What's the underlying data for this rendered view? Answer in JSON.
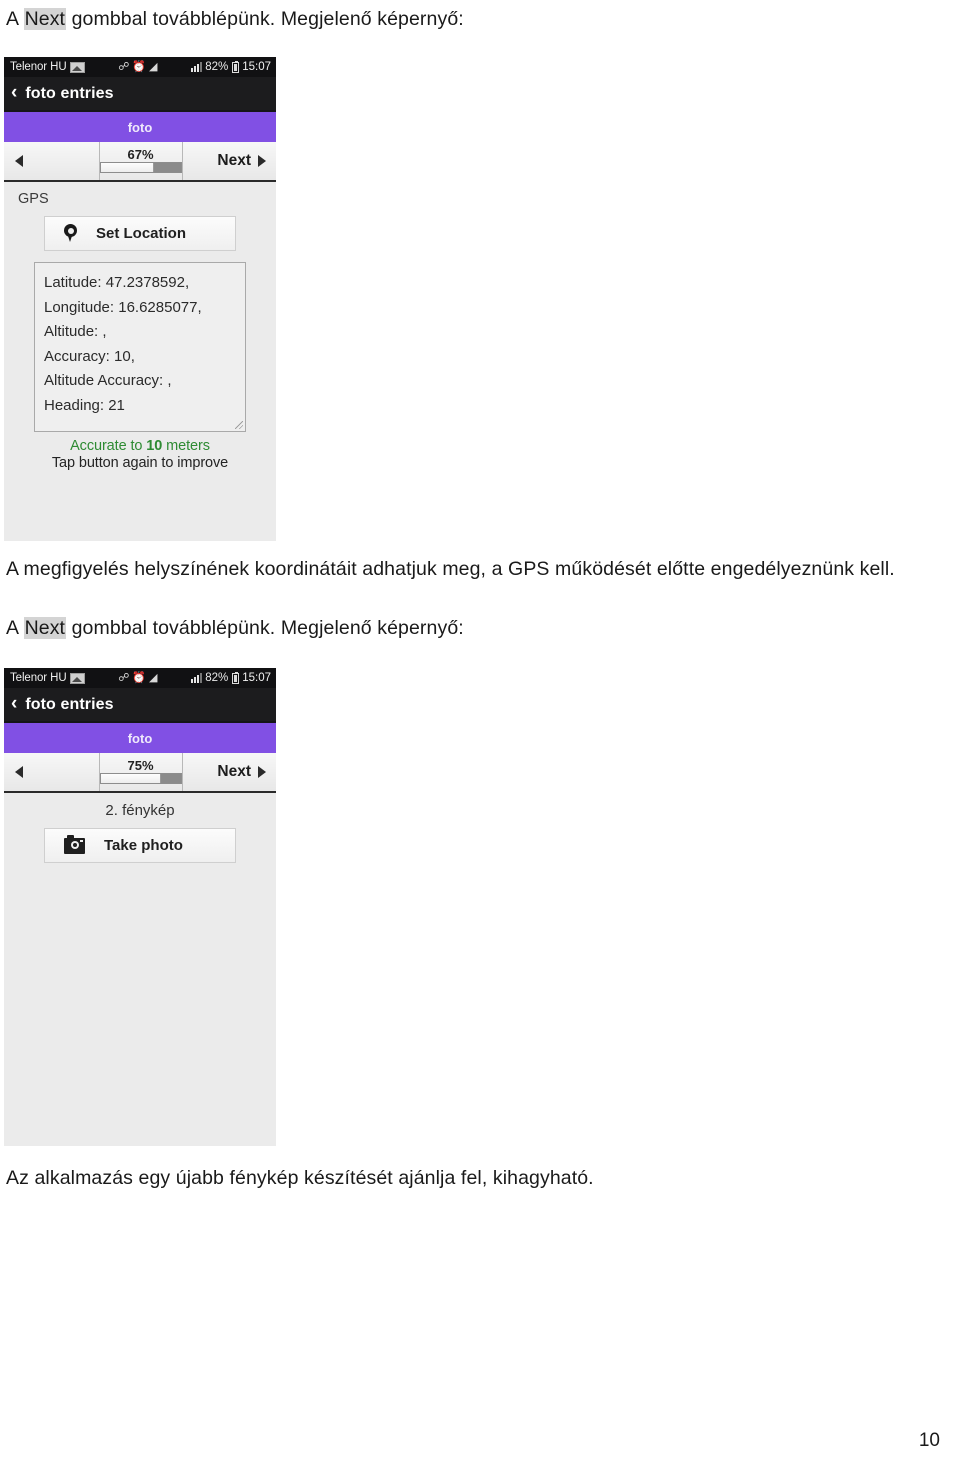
{
  "document": {
    "paragraph_1": "A Next gombbal továbblépünk. Megjelenő képernyő:",
    "paragraph_1_prefix": "A ",
    "paragraph_1_highlight": "Next",
    "paragraph_1_suffix": " gombbal továbblépünk. Megjelenő képernyő:",
    "paragraph_2": "A megfigyelés helyszínének koordinátáit adhatjuk meg, a GPS működését előtte engedélyeznünk kell.",
    "paragraph_3_prefix": "A ",
    "paragraph_3_highlight": "Next",
    "paragraph_3_suffix": " gombbal továbblépünk. Megjelenő képernyő:",
    "paragraph_4": "Az alkalmazás egy újabb fénykép készítését ajánlja fel, kihagyható.",
    "page_number": "10"
  },
  "screenshot_1": {
    "status_bar": {
      "carrier": "Telenor HU",
      "battery_percent": "82%",
      "clock": "15:07",
      "icons": [
        "screenshot-icon",
        "bluetooth-icon",
        "alarm-clock-icon",
        "wifi-icon",
        "signal-bars-icon",
        "battery-icon"
      ]
    },
    "action_bar": {
      "back_label": "‹",
      "title": "foto entries"
    },
    "form_title": "foto",
    "nav": {
      "prev_label": "",
      "percent_label": "67%",
      "percent_value": 67,
      "next_label": "Next"
    },
    "fields": {
      "gps_label": "GPS",
      "set_location_label": "Set Location",
      "readout": [
        "Latitude: 47.2378592,",
        "Longitude: 16.6285077,",
        "Altitude: ,",
        "Accuracy: 10,",
        "Altitude Accuracy: ,",
        "Heading: 21"
      ],
      "accuracy_prefix": "Accurate to ",
      "accuracy_value": "10",
      "accuracy_suffix": " meters",
      "accuracy_hint": "Tap button again to improve"
    }
  },
  "screenshot_2": {
    "status_bar": {
      "carrier": "Telenor HU",
      "battery_percent": "82%",
      "clock": "15:07",
      "icons": [
        "screenshot-icon",
        "bluetooth-icon",
        "alarm-clock-icon",
        "wifi-icon",
        "signal-bars-icon",
        "battery-icon"
      ]
    },
    "action_bar": {
      "back_label": "‹",
      "title": "foto entries"
    },
    "form_title": "foto",
    "nav": {
      "prev_label": "",
      "percent_label": "75%",
      "percent_value": 75,
      "next_label": "Next"
    },
    "fields": {
      "photo_label": "2. fénykép",
      "take_photo_label": "Take photo"
    }
  },
  "colors": {
    "purple_bar": "#8150e4",
    "status_bar": "#111113",
    "action_bar": "#1c1c1e",
    "screen_bg": "#ebebeb",
    "accuracy_green": "#2e8b33",
    "highlight_gray": "#d4d4d4"
  }
}
